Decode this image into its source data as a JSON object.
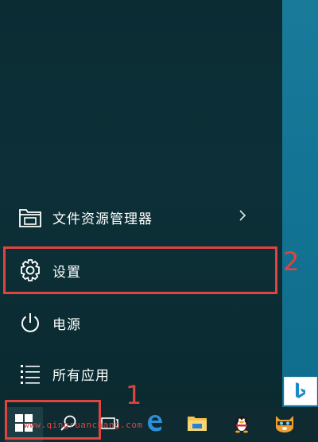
{
  "start_menu": {
    "items": [
      {
        "label": "文件资源管理器",
        "icon": "file-explorer-icon",
        "has_submenu": true
      },
      {
        "label": "设置",
        "icon": "gear-icon"
      },
      {
        "label": "电源",
        "icon": "power-icon"
      },
      {
        "label": "所有应用",
        "icon": "all-apps-icon"
      }
    ]
  },
  "annotations": {
    "step_1": "1",
    "step_2": "2"
  },
  "taskbar": {
    "watermark": "www.qingruanchang.com",
    "icons": [
      "windows-start-icon",
      "search-icon",
      "task-view-icon",
      "edge-icon",
      "file-explorer-icon",
      "qq-penguin-icon",
      "cat-app-icon"
    ]
  },
  "tiles": {
    "bing": "bing-icon"
  },
  "colors": {
    "menu_bg": "#0b2c33",
    "tile_area": "#137394",
    "highlight_red": "#e0443f",
    "taskbar": "#0f2a30"
  }
}
